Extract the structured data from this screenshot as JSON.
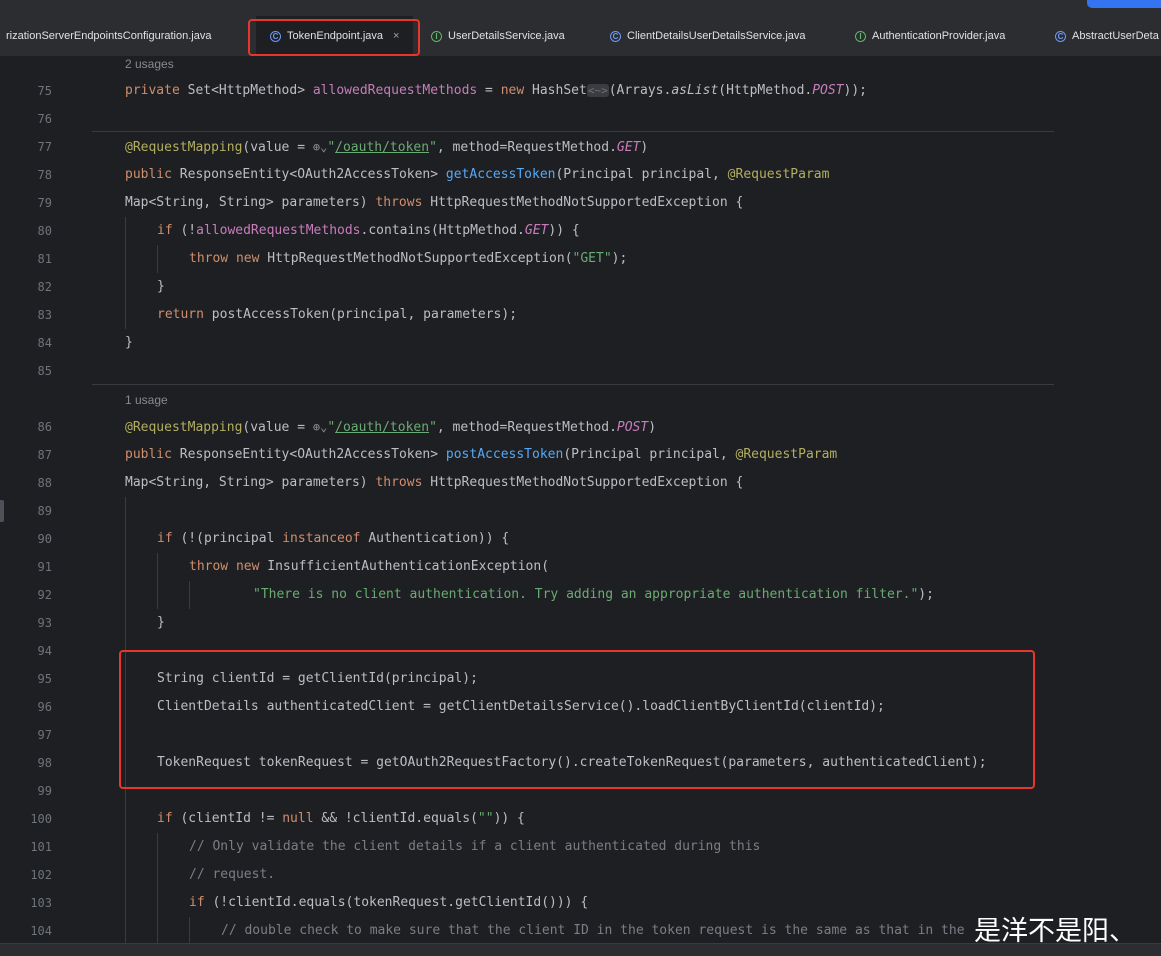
{
  "tabs": [
    {
      "label": "rizationServerEndpointsConfiguration.java",
      "icon": "none",
      "active": false
    },
    {
      "label": "TokenEndpoint.java",
      "icon": "class-icon",
      "active": true,
      "close": "×"
    },
    {
      "label": "UserDetailsService.java",
      "icon": "interface-icon",
      "active": false
    },
    {
      "label": "ClientDetailsUserDetailsService.java",
      "icon": "class-icon",
      "active": false
    },
    {
      "label": "AuthenticationProvider.java",
      "icon": "interface-icon",
      "active": false
    },
    {
      "label": "AbstractUserDeta",
      "icon": "class-icon",
      "active": false
    }
  ],
  "usages": {
    "top": "2 usages",
    "post": "1 usage"
  },
  "line_numbers": [
    "75",
    "76",
    "77",
    "78",
    "79",
    "80",
    "81",
    "82",
    "83",
    "84",
    "85",
    "86",
    "87",
    "88",
    "89",
    "90",
    "91",
    "92",
    "93",
    "94",
    "95",
    "96",
    "97",
    "98",
    "99",
    "100",
    "101",
    "102",
    "103",
    "104"
  ],
  "code": {
    "l75": {
      "t1": "private ",
      "t2": "Set<HttpMethod> ",
      "t3": "allowedRequestMethods",
      "t4": " = ",
      "t5": "new ",
      "t6": "HashSet",
      "t7": "<~>",
      "t8": "(Arrays.",
      "t9": "asList",
      "t10": "(HttpMethod.",
      "t11": "POST",
      "t12": "));"
    },
    "l77": {
      "t1": "@RequestMapping",
      "t2": "(value = ",
      "t3": "⊕⌄",
      "t4": "\"",
      "t5": "/oauth/token",
      "t6": "\"",
      "t7": ", method=RequestMethod.",
      "t8": "GET",
      "t9": ")"
    },
    "l78": {
      "t1": "public ",
      "t2": "ResponseEntity<OAuth2AccessToken> ",
      "t3": "getAccessToken",
      "t4": "(Principal principal, ",
      "t5": "@RequestParam"
    },
    "l79": {
      "t1": "Map<String, String> parameters) ",
      "t2": "throws ",
      "t3": "HttpRequestMethodNotSupportedException {"
    },
    "l80": {
      "t1": "if ",
      "t2": "(!",
      "t3": "allowedRequestMethods",
      "t4": ".contains(HttpMethod.",
      "t5": "GET",
      "t6": ")) {"
    },
    "l81": {
      "t1": "throw new ",
      "t2": "HttpRequestMethodNotSupportedException(",
      "t3": "\"GET\"",
      "t4": ");"
    },
    "l82": {
      "t1": "}"
    },
    "l83": {
      "t1": "return ",
      "t2": "postAccessToken(principal, parameters);"
    },
    "l84": {
      "t1": "}"
    },
    "l86": {
      "t1": "@RequestMapping",
      "t2": "(value = ",
      "t3": "⊕⌄",
      "t4": "\"",
      "t5": "/oauth/token",
      "t6": "\"",
      "t7": ", method=RequestMethod.",
      "t8": "POST",
      "t9": ")"
    },
    "l87": {
      "t1": "public ",
      "t2": "ResponseEntity<OAuth2AccessToken> ",
      "t3": "postAccessToken",
      "t4": "(Principal principal, ",
      "t5": "@RequestParam"
    },
    "l88": {
      "t1": "Map<String, String> parameters) ",
      "t2": "throws ",
      "t3": "HttpRequestMethodNotSupportedException {"
    },
    "l90": {
      "t1": "if ",
      "t2": "(!(principal ",
      "t3": "instanceof ",
      "t4": "Authentication)) {"
    },
    "l91": {
      "t1": "throw new ",
      "t2": "InsufficientAuthenticationException("
    },
    "l92": {
      "t1": "\"There is no client authentication. Try adding an appropriate authentication filter.\"",
      "t2": ");"
    },
    "l93": {
      "t1": "}"
    },
    "l95": {
      "t1": "String clientId = getClientId(principal);"
    },
    "l96": {
      "t1": "ClientDetails authenticatedClient = getClientDetailsService().loadClientByClientId(clientId);"
    },
    "l98": {
      "t1": "TokenRequest tokenRequest = getOAuth2RequestFactory().createTokenRequest(parameters, authenticatedClient);"
    },
    "l100": {
      "t1": "if ",
      "t2": "(clientId != ",
      "t3": "null ",
      "t4": "&& !clientId.equals(",
      "t5": "\"\"",
      "t6": ")) {"
    },
    "l101": {
      "t1": "// Only validate the client details if a client authenticated during this"
    },
    "l102": {
      "t1": "// request."
    },
    "l103": {
      "t1": "if ",
      "t2": "(!clientId.equals(tokenRequest.getClientId())) {"
    },
    "l104": {
      "t1": "// double check to make sure that the client ID in the token request is the same as that in the"
    }
  },
  "watermark": "是洋不是阳、",
  "colors": {
    "highlight_box": "#e5372b",
    "accent": "#3574f0"
  }
}
